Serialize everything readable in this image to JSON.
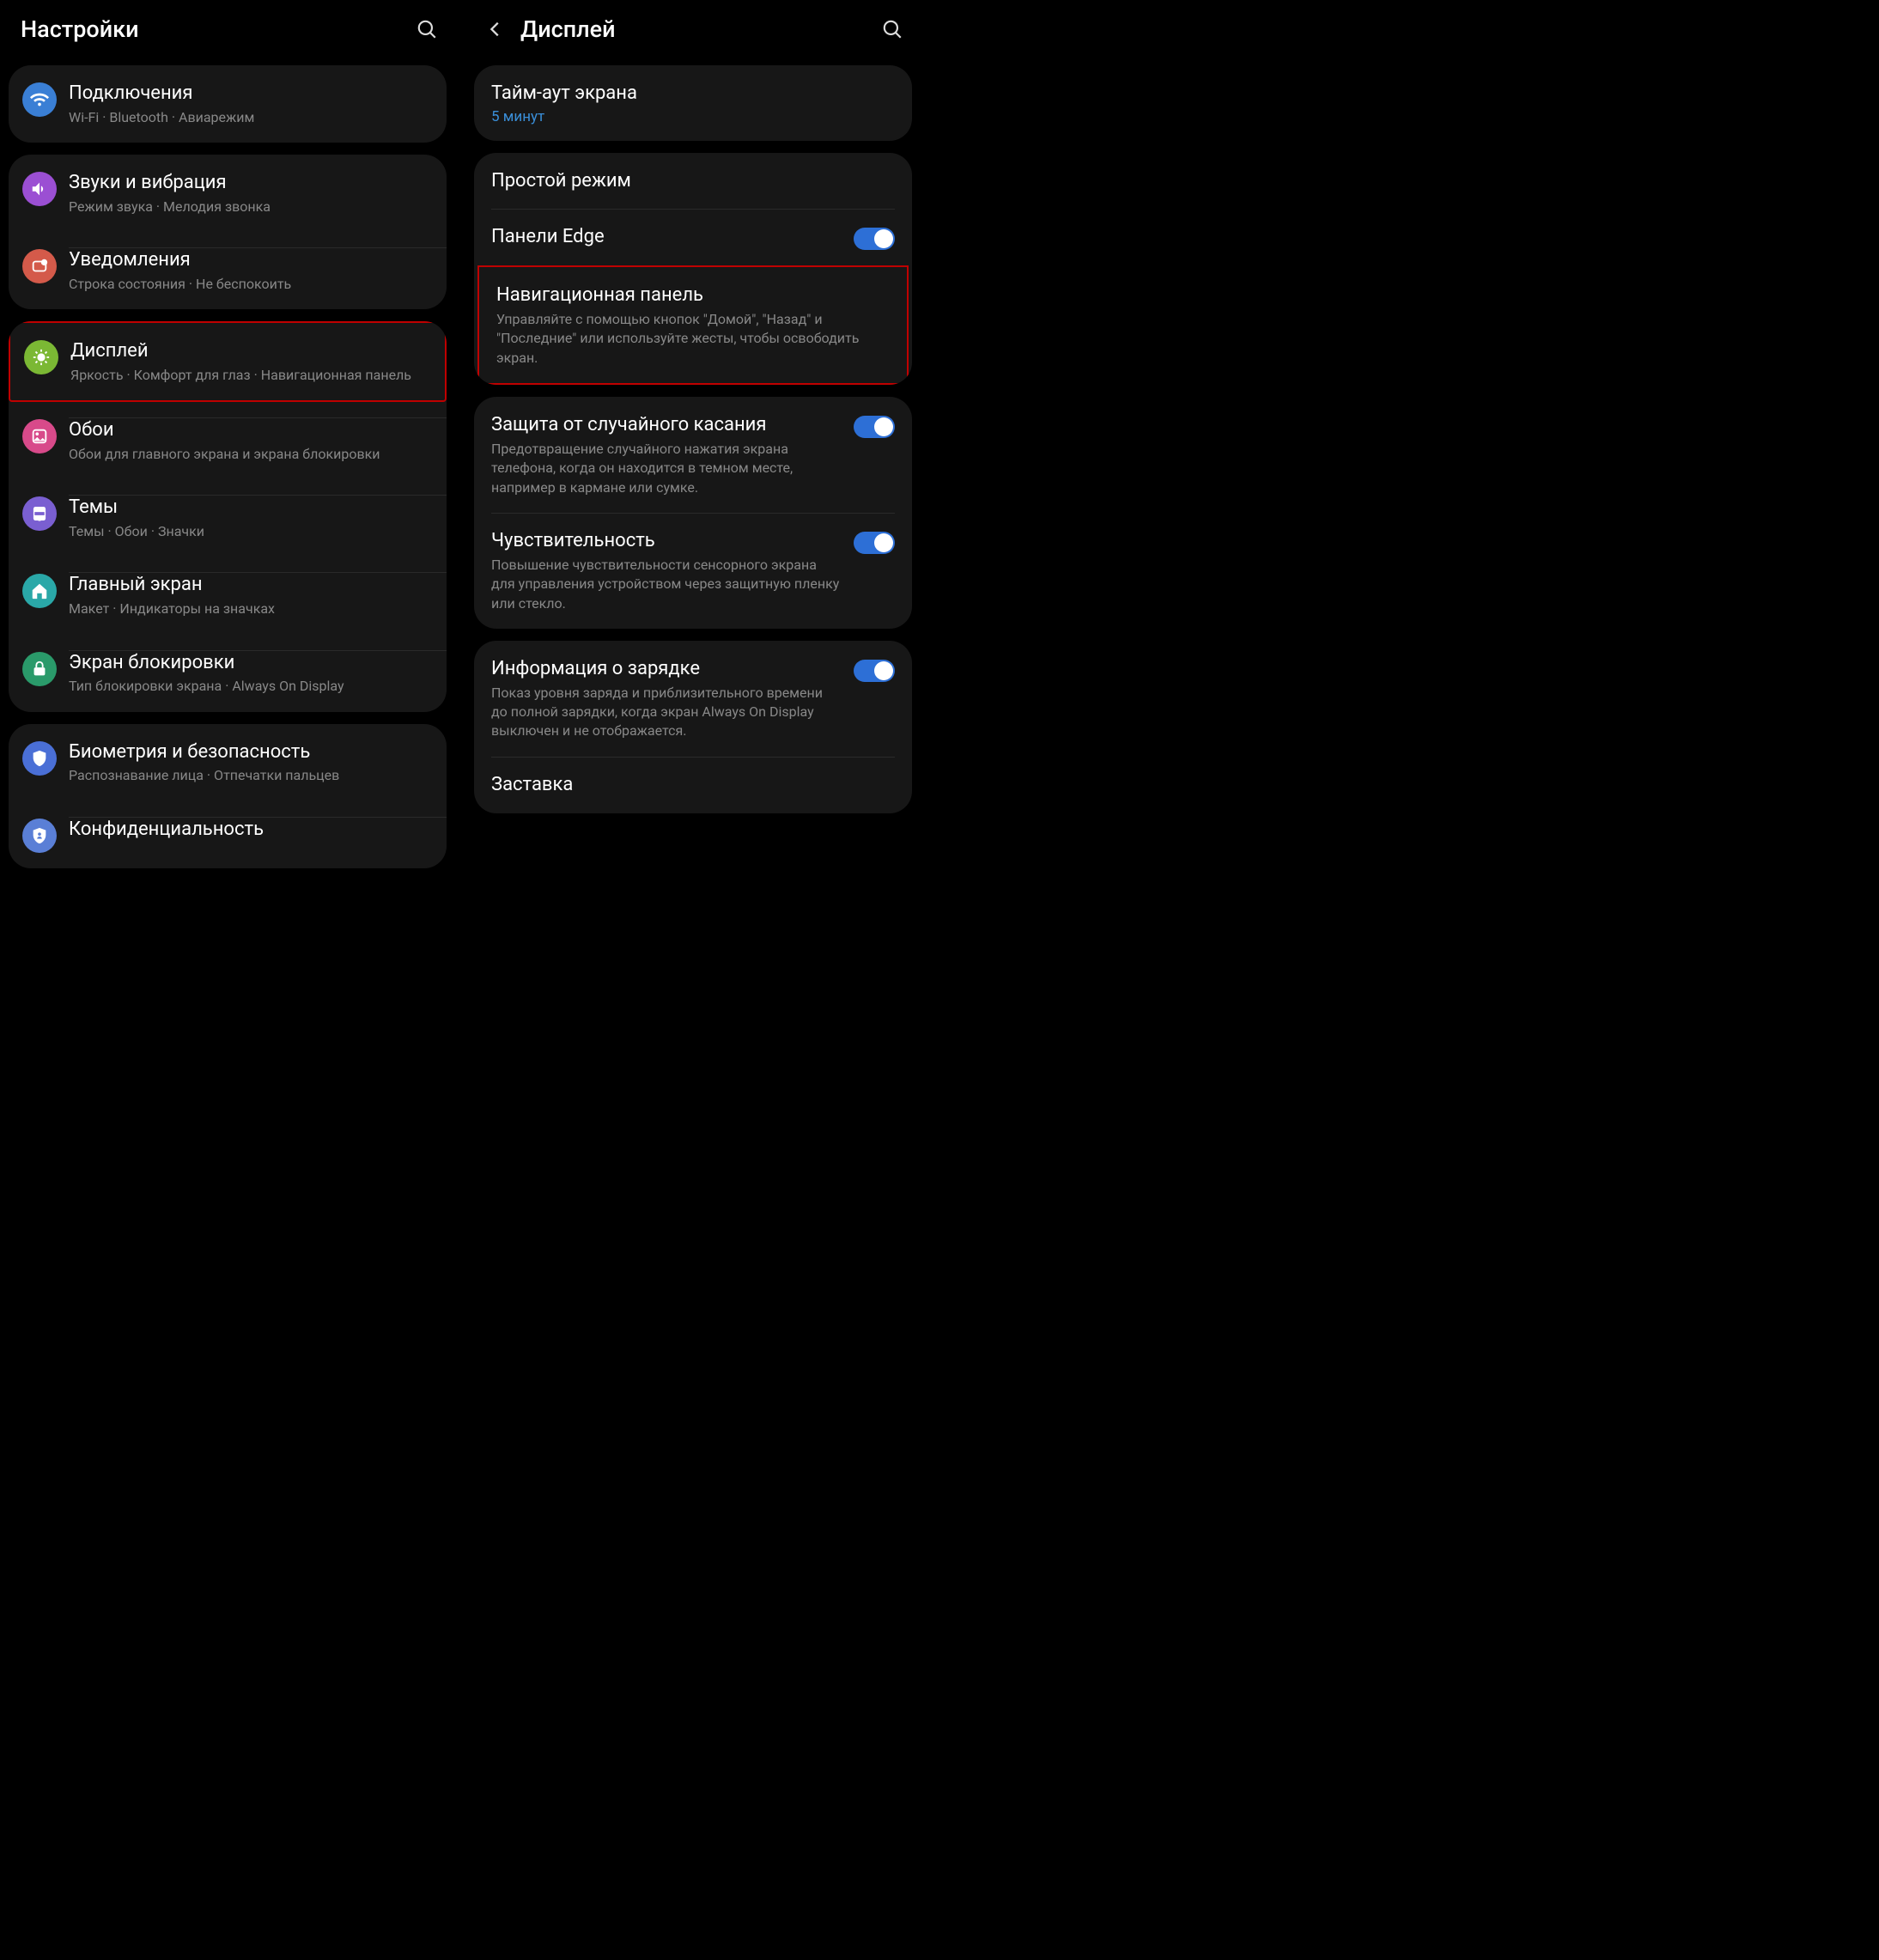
{
  "left": {
    "title": "Настройки",
    "items": [
      {
        "title": "Подключения",
        "sub": "Wi-Fi · Bluetooth · Авиарежим",
        "icon": "wifi",
        "color": "#3a7fd5"
      },
      {
        "title": "Звуки и вибрация",
        "sub": "Режим звука · Мелодия звонка",
        "icon": "sound",
        "color": "#9b4fd3"
      },
      {
        "title": "Уведомления",
        "sub": "Строка состояния · Не беспокоить",
        "icon": "notif",
        "color": "#d45a4a"
      },
      {
        "title": "Дисплей",
        "sub": "Яркость · Комфорт для глаз · Навигационная панель",
        "icon": "display",
        "color": "#7bb834",
        "highlight": true
      },
      {
        "title": "Обои",
        "sub": "Обои для главного экрана и экрана блокировки",
        "icon": "wallpaper",
        "color": "#d84a8a"
      },
      {
        "title": "Темы",
        "sub": "Темы · Обои · Значки",
        "icon": "themes",
        "color": "#7a5fd1"
      },
      {
        "title": "Главный экран",
        "sub": "Макет · Индикаторы на значках",
        "icon": "home",
        "color": "#2aa8a8"
      },
      {
        "title": "Экран блокировки",
        "sub": "Тип блокировки экрана · Always On Display",
        "icon": "lock",
        "color": "#2a9a6a"
      },
      {
        "title": "Биометрия и безопасность",
        "sub": "Распознавание лица · Отпечатки пальцев",
        "icon": "shield",
        "color": "#4a6fd6"
      },
      {
        "title": "Конфиденциальность",
        "sub": "",
        "icon": "privacy",
        "color": "#5a7fd6"
      }
    ]
  },
  "right": {
    "title": "Дисплей",
    "groups": [
      [
        {
          "title": "Тайм-аут экрана",
          "sub_blue": "5 минут"
        }
      ],
      [
        {
          "title": "Простой режим"
        },
        {
          "title": "Панели Edge",
          "toggle": true
        },
        {
          "title": "Навигационная панель",
          "sub": "Управляйте с помощью кнопок \"Домой\", \"Назад\" и \"Последние\" или используйте жесты, чтобы освободить экран.",
          "highlight": true
        }
      ],
      [
        {
          "title": "Защита от случайного касания",
          "sub": "Предотвращение случайного нажатия экрана телефона, когда он находится в темном месте, например в кармане или сумке.",
          "toggle": true
        },
        {
          "title": "Чувствительность",
          "sub": "Повышение чувствительности сенсорного экрана для управления устройством через защитную пленку или стекло.",
          "toggle": true
        }
      ],
      [
        {
          "title": "Информация о зарядке",
          "sub": "Показ уровня заряда и приблизительного времени до полной зарядки, когда экран Always On Display выключен и не отображается.",
          "toggle": true
        },
        {
          "title": "Заставка"
        }
      ]
    ]
  }
}
